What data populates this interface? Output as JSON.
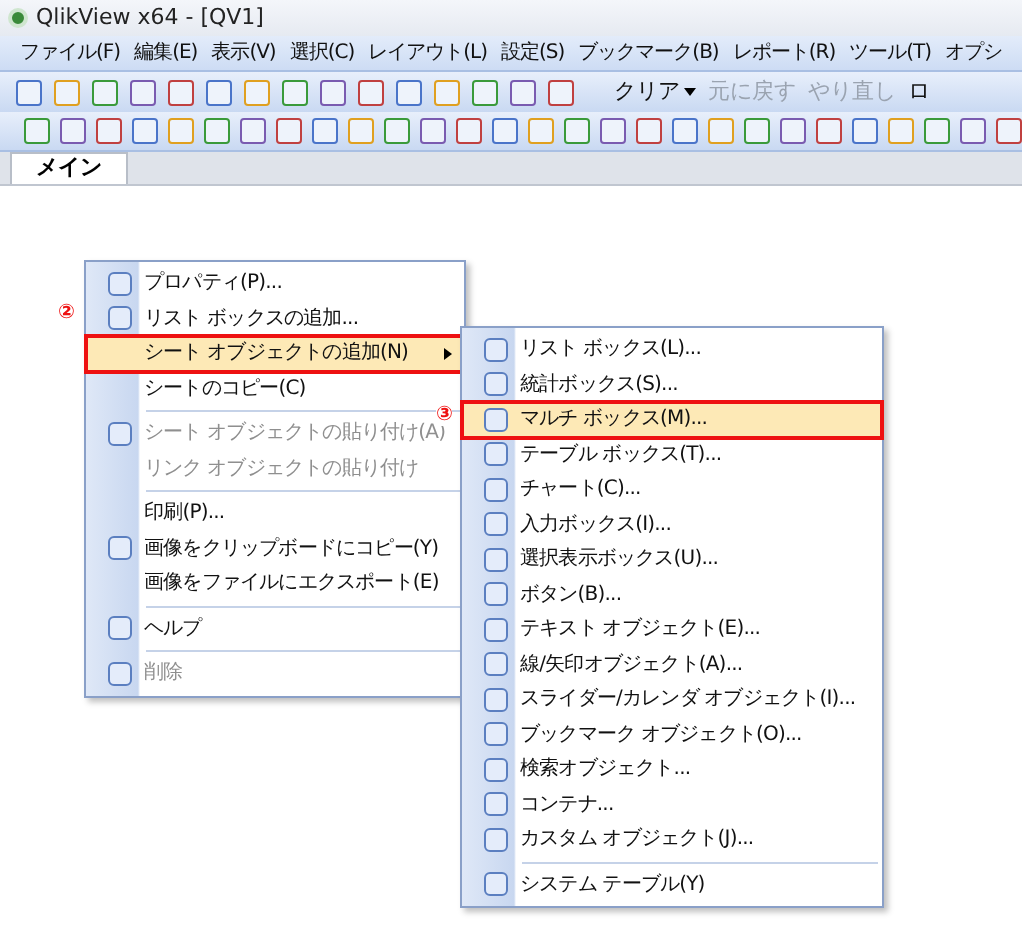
{
  "window": {
    "title": "QlikView x64 - [QV1]"
  },
  "menu_bar": [
    "ファイル(F)",
    "編集(E)",
    "表示(V)",
    "選択(C)",
    "レイアウト(L)",
    "設定(S)",
    "ブックマーク(B)",
    "レポート(R)",
    "ツール(T)",
    "オプシ"
  ],
  "toolbar": {
    "buttons": [
      {
        "label": "クリア",
        "disabled": false,
        "dropdown": true
      },
      {
        "label": "元に戻す",
        "disabled": true,
        "dropdown": false
      },
      {
        "label": "やり直し",
        "disabled": true,
        "dropdown": false
      },
      {
        "label": "ロ",
        "disabled": false,
        "dropdown": false
      }
    ]
  },
  "tabs": [
    {
      "label": "メイン",
      "selected": true
    }
  ],
  "context_menu": {
    "items": [
      {
        "kind": "item",
        "label": "プロパティ(P)...",
        "disabled": false,
        "selected": false,
        "submenu": false
      },
      {
        "kind": "item",
        "label": "リスト ボックスの追加...",
        "disabled": false,
        "selected": false,
        "submenu": false
      },
      {
        "kind": "item",
        "label": "シート オブジェクトの追加(N)",
        "disabled": false,
        "selected": true,
        "submenu": true
      },
      {
        "kind": "item",
        "label": "シートのコピー(C)",
        "disabled": false,
        "selected": false,
        "submenu": false
      },
      {
        "kind": "separator"
      },
      {
        "kind": "item",
        "label": "シート オブジェクトの貼り付け(A)",
        "disabled": true,
        "selected": false,
        "submenu": false
      },
      {
        "kind": "item",
        "label": "リンク オブジェクトの貼り付け",
        "disabled": true,
        "selected": false,
        "submenu": false
      },
      {
        "kind": "separator"
      },
      {
        "kind": "item",
        "label": "印刷(P)...",
        "disabled": false,
        "selected": false,
        "submenu": false
      },
      {
        "kind": "item",
        "label": "画像をクリップボードにコピー(Y)",
        "disabled": false,
        "selected": false,
        "submenu": false
      },
      {
        "kind": "item",
        "label": "画像をファイルにエクスポート(E)",
        "disabled": false,
        "selected": false,
        "submenu": false
      },
      {
        "kind": "separator"
      },
      {
        "kind": "item",
        "label": "ヘルプ",
        "disabled": false,
        "selected": false,
        "submenu": false
      },
      {
        "kind": "separator"
      },
      {
        "kind": "item",
        "label": "削除",
        "disabled": true,
        "selected": false,
        "submenu": false
      }
    ]
  },
  "submenu": {
    "items": [
      {
        "kind": "item",
        "label": "リスト ボックス(L)...",
        "selected": false
      },
      {
        "kind": "item",
        "label": "統計ボックス(S)...",
        "selected": false
      },
      {
        "kind": "item",
        "label": "マルチ ボックス(M)...",
        "selected": true
      },
      {
        "kind": "item",
        "label": "テーブル ボックス(T)...",
        "selected": false
      },
      {
        "kind": "item",
        "label": "チャート(C)...",
        "selected": false
      },
      {
        "kind": "item",
        "label": "入力ボックス(I)...",
        "selected": false
      },
      {
        "kind": "item",
        "label": "選択表示ボックス(U)...",
        "selected": false
      },
      {
        "kind": "item",
        "label": "ボタン(B)...",
        "selected": false
      },
      {
        "kind": "item",
        "label": "テキスト オブジェクト(E)...",
        "selected": false
      },
      {
        "kind": "item",
        "label": "線/矢印オブジェクト(A)...",
        "selected": false
      },
      {
        "kind": "item",
        "label": "スライダー/カレンダ オブジェクト(I)...",
        "selected": false
      },
      {
        "kind": "item",
        "label": "ブックマーク オブジェクト(O)...",
        "selected": false
      },
      {
        "kind": "item",
        "label": "検索オブジェクト...",
        "selected": false
      },
      {
        "kind": "item",
        "label": "コンテナ...",
        "selected": false
      },
      {
        "kind": "item",
        "label": "カスタム オブジェクト(J)...",
        "selected": false
      },
      {
        "kind": "separator"
      },
      {
        "kind": "item",
        "label": "システム テーブル(Y)",
        "selected": false
      }
    ]
  },
  "annotations": [
    "②",
    "③"
  ]
}
